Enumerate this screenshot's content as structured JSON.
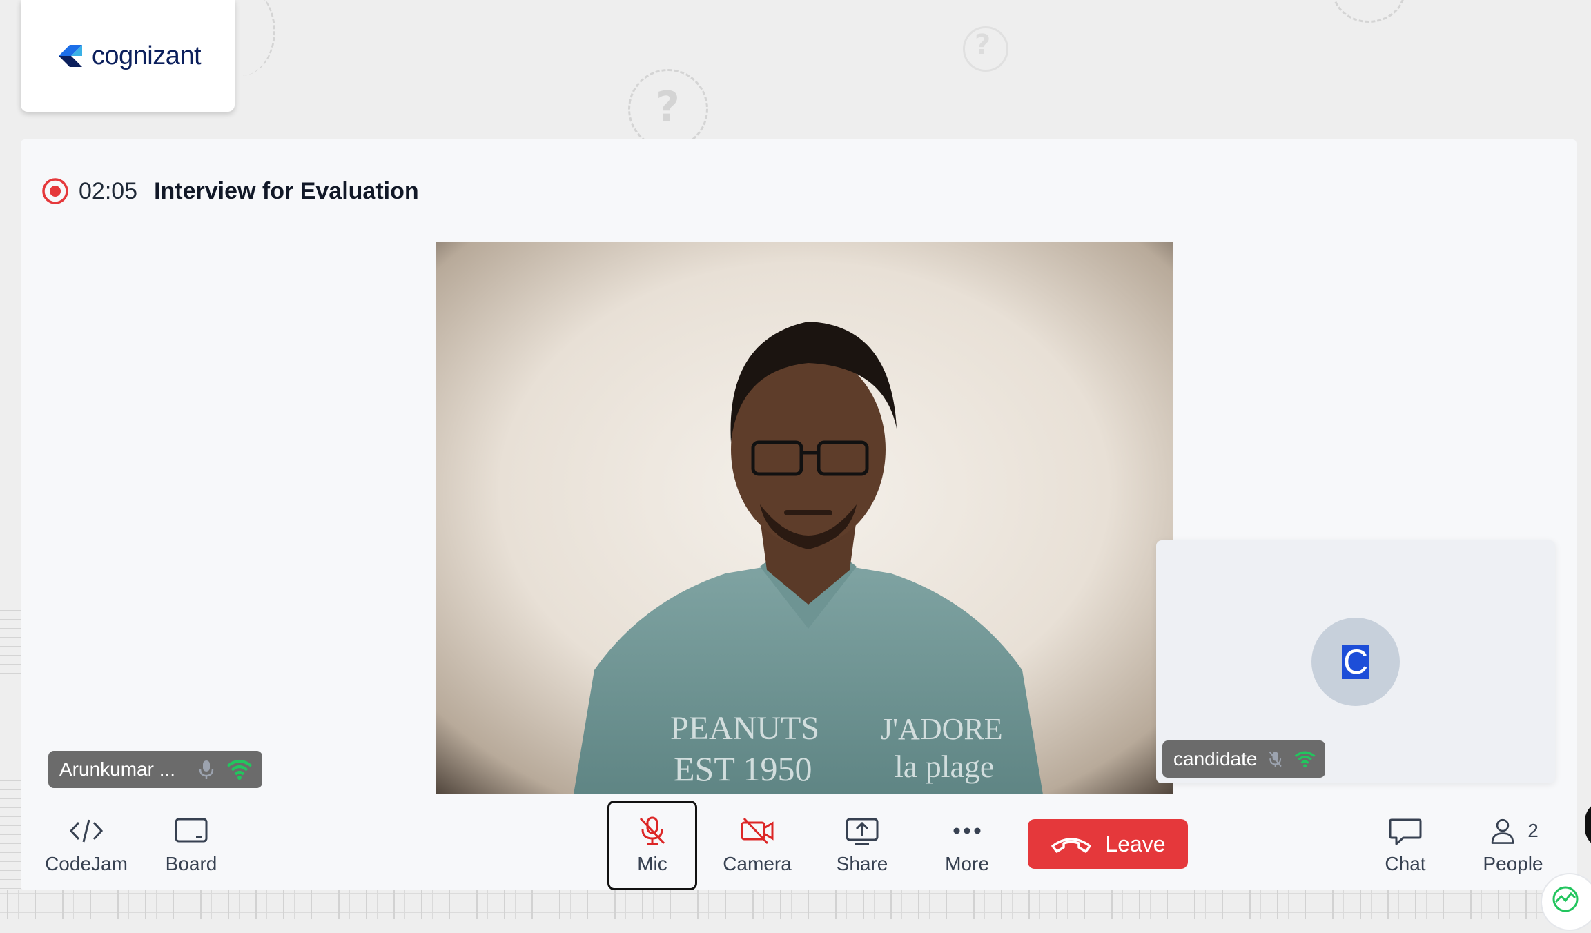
{
  "brand": {
    "logo_text": "cognizant",
    "logo_icon": "cognizant-logo-icon"
  },
  "header": {
    "recording_icon": "record-icon",
    "timer": "02:05",
    "title": "Interview for Evaluation"
  },
  "participants": {
    "local": {
      "name": "Arunkumar ...",
      "mic_icon": "mic-icon",
      "signal_icon": "wifi-signal-icon"
    },
    "remote": {
      "name": "candidate",
      "avatar_initial": "C",
      "mic_icon": "mic-off-icon",
      "signal_icon": "wifi-signal-icon"
    }
  },
  "toolbar": {
    "codejam": {
      "label": "CodeJam",
      "icon": "code-icon"
    },
    "board": {
      "label": "Board",
      "icon": "whiteboard-icon"
    },
    "mic": {
      "label": "Mic",
      "icon": "mic-off-icon",
      "state": "muted"
    },
    "camera": {
      "label": "Camera",
      "icon": "camera-off-icon",
      "state": "off"
    },
    "share": {
      "label": "Share",
      "icon": "share-screen-icon"
    },
    "more": {
      "label": "More",
      "icon": "more-dots-icon"
    },
    "leave": {
      "label": "Leave",
      "icon": "hang-up-icon"
    },
    "chat": {
      "label": "Chat",
      "icon": "chat-icon"
    },
    "people": {
      "label": "People",
      "icon": "person-icon",
      "count": "2"
    }
  },
  "colors": {
    "danger": "#e5383b",
    "muted_icon": "#dc2626",
    "signal": "#22c55e",
    "panel": "#f7f8fa",
    "tag_bg": "#6b6b6b"
  }
}
